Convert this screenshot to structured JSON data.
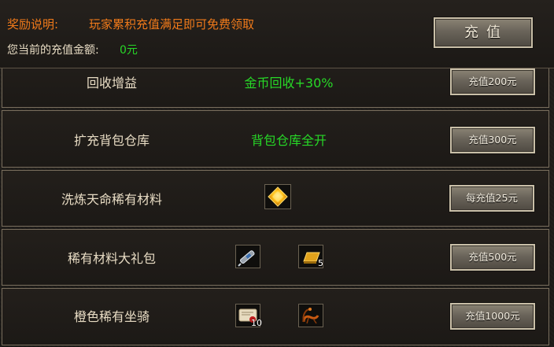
{
  "header": {
    "reward_label": "奖励说明:",
    "reward_text": "玩家累积充值满足即可免费领取",
    "amount_label": "您当前的充值金额:",
    "amount_value": "0元",
    "recharge_button": "充值"
  },
  "rows": [
    {
      "title": "回收增益",
      "desc": "金币回收+30%",
      "button": "充值200元"
    },
    {
      "title": "扩充背包仓库",
      "desc": "背包仓库全开",
      "button": "充值300元"
    },
    {
      "title": "洗炼天命稀有材料",
      "button": "每充值25元",
      "items": [
        {
          "icon": "gold-gem-icon"
        }
      ]
    },
    {
      "title": "稀有材料大礼包",
      "button": "充值500元",
      "items": [
        {
          "icon": "syringe-icon"
        },
        {
          "icon": "gold-bar-icon",
          "count": "5"
        }
      ]
    },
    {
      "title": "橙色稀有坐骑",
      "button": "充值1000元",
      "items": [
        {
          "icon": "scroll-icon",
          "count": "10"
        },
        {
          "icon": "scorpion-mount-icon"
        }
      ]
    }
  ],
  "colors": {
    "accent_orange": "#f07a1a",
    "value_green": "#27d827",
    "label_text": "#e8dcc4"
  }
}
